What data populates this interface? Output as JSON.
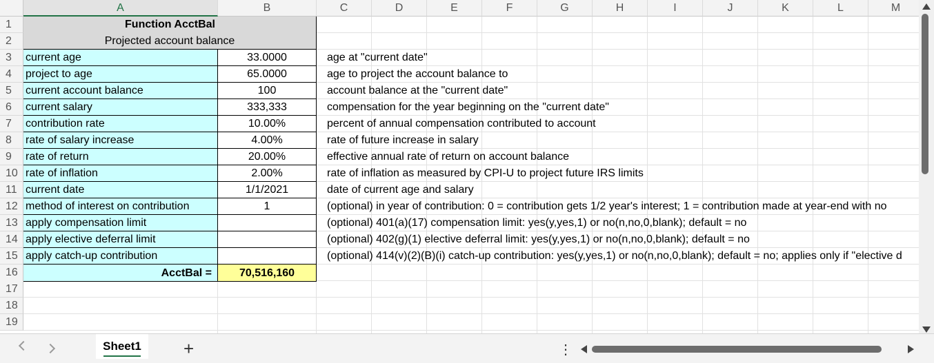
{
  "columns": [
    "A",
    "B",
    "C",
    "D",
    "E",
    "F",
    "G",
    "H",
    "I",
    "J",
    "K",
    "L",
    "M"
  ],
  "rows": [
    "1",
    "2",
    "3",
    "4",
    "5",
    "6",
    "7",
    "8",
    "9",
    "10",
    "11",
    "12",
    "13",
    "14",
    "15",
    "16",
    "17",
    "18",
    "19"
  ],
  "title": "Function AcctBal",
  "subtitle": "Projected account balance",
  "params": [
    {
      "label": "current age",
      "value": "33.0000",
      "desc": "age at \"current date\""
    },
    {
      "label": "project to age",
      "value": "65.0000",
      "desc": "age to project the account balance to"
    },
    {
      "label": "current account balance",
      "value": "100",
      "desc": "account balance at the \"current date\""
    },
    {
      "label": "current salary",
      "value": "333,333",
      "desc": "compensation for the year beginning on the \"current date\""
    },
    {
      "label": "contribution rate",
      "value": "10.00%",
      "desc": "percent of annual compensation contributed to account"
    },
    {
      "label": "rate of salary increase",
      "value": "4.00%",
      "desc": "rate of future increase in salary"
    },
    {
      "label": "rate of return",
      "value": "20.00%",
      "desc": "effective annual rate of return on account balance"
    },
    {
      "label": "rate of inflation",
      "value": "2.00%",
      "desc": "rate of inflation as measured by CPI-U to project future IRS limits"
    },
    {
      "label": "current date",
      "value": "1/1/2021",
      "desc": "date of current age and salary"
    },
    {
      "label": "method of interest on contribution",
      "value": "1",
      "desc": "(optional) in year of contribution: 0 = contribution gets 1/2 year's interest; 1 = contribution made at year-end with no"
    },
    {
      "label": "apply compensation limit",
      "value": "",
      "desc": "(optional) 401(a)(17) compensation limit: yes(y,yes,1) or no(n,no,0,blank); default = no"
    },
    {
      "label": "apply elective deferral limit",
      "value": "",
      "desc": "(optional) 402(g)(1) elective deferral limit: yes(y,yes,1) or no(n,no,0,blank); default = no"
    },
    {
      "label": "apply catch-up contribution",
      "value": "",
      "desc": "(optional) 414(v)(2)(B)(i) catch-up contribution: yes(y,yes,1) or no(n,no,0,blank); default = no; applies only if \"elective d"
    }
  ],
  "result": {
    "label": "AcctBal =",
    "value": "70,516,160"
  },
  "sheet_tab": "Sheet1",
  "add_sheet": "+",
  "more_options": "⋮",
  "colors": {
    "accent": "#217346",
    "input_fill": "#ccffff",
    "result_fill": "#ffff99",
    "title_fill": "#d9d9d9"
  }
}
